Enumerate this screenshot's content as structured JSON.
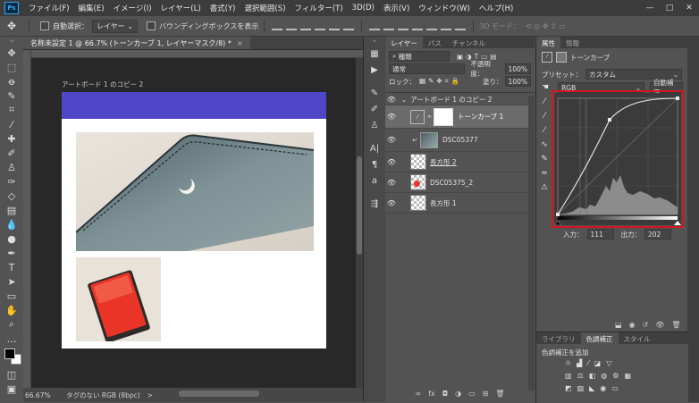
{
  "app": {
    "logo": "Ps"
  },
  "menu": [
    "ファイル(F)",
    "編集(E)",
    "イメージ(I)",
    "レイヤー(L)",
    "書式(Y)",
    "選択範囲(S)",
    "フィルター(T)",
    "3D(D)",
    "表示(V)",
    "ウィンドウ(W)",
    "ヘルプ(H)"
  ],
  "window_controls": [
    "—",
    "□",
    "✕"
  ],
  "options": {
    "auto_select_label": "自動選択：",
    "auto_select_value": "レイヤー",
    "bounding_box_label": "バウンディングボックスを表示",
    "mode_3d": "3D モード："
  },
  "document": {
    "tab_title": "名称未設定 1 @ 66.7% (トーンカーブ 1, レイヤーマスク/8) *",
    "tab_close": "×",
    "artboard_label": "アートボード 1 のコピー 2",
    "status_zoom": "66.67%",
    "status_info": "タグのない RGB (8bpc)",
    "status_arrow": ">"
  },
  "layers_panel": {
    "tabs": [
      "レイヤー",
      "パス",
      "チャンネル"
    ],
    "filter_kind": "種類",
    "blend_mode": "通常",
    "opacity_label": "不透明度：",
    "opacity_value": "100%",
    "lock_label": "ロック：",
    "fill_label": "塗り：",
    "fill_value": "100%",
    "layers": [
      {
        "name": "アートボード 1 のコピー 2",
        "type": "artboard"
      },
      {
        "name": "トーンカーブ 1",
        "type": "adjustment",
        "selected": true
      },
      {
        "name": "DSC05377",
        "type": "image"
      },
      {
        "name": "長方形 2",
        "type": "shape"
      },
      {
        "name": "DSC05375_2",
        "type": "image"
      },
      {
        "name": "長方形 1",
        "type": "shape"
      }
    ],
    "footer_icons": [
      "link-icon",
      "fx-icon",
      "mask-icon",
      "adjustment-icon",
      "folder-icon",
      "new-layer-icon",
      "trash-icon"
    ]
  },
  "properties_panel": {
    "tabs": [
      "属性",
      "情報"
    ],
    "title": "トーンカーブ",
    "preset_label": "プリセット：",
    "preset_value": "カスタム",
    "channel": "RGB",
    "auto_button": "自動補正",
    "input_label": "入力：",
    "input_value": "111",
    "output_label": "出力：",
    "output_value": "202"
  },
  "adjustments_panel": {
    "tabs": [
      "ライブラリ",
      "色調補正",
      "スタイル"
    ],
    "add_label": "色調補正を追加"
  },
  "colors": {
    "artboard_header": "#5046c8",
    "highlight_box": "#d6141e",
    "background_color": "#ffffff",
    "foreground_color": "#000000"
  }
}
